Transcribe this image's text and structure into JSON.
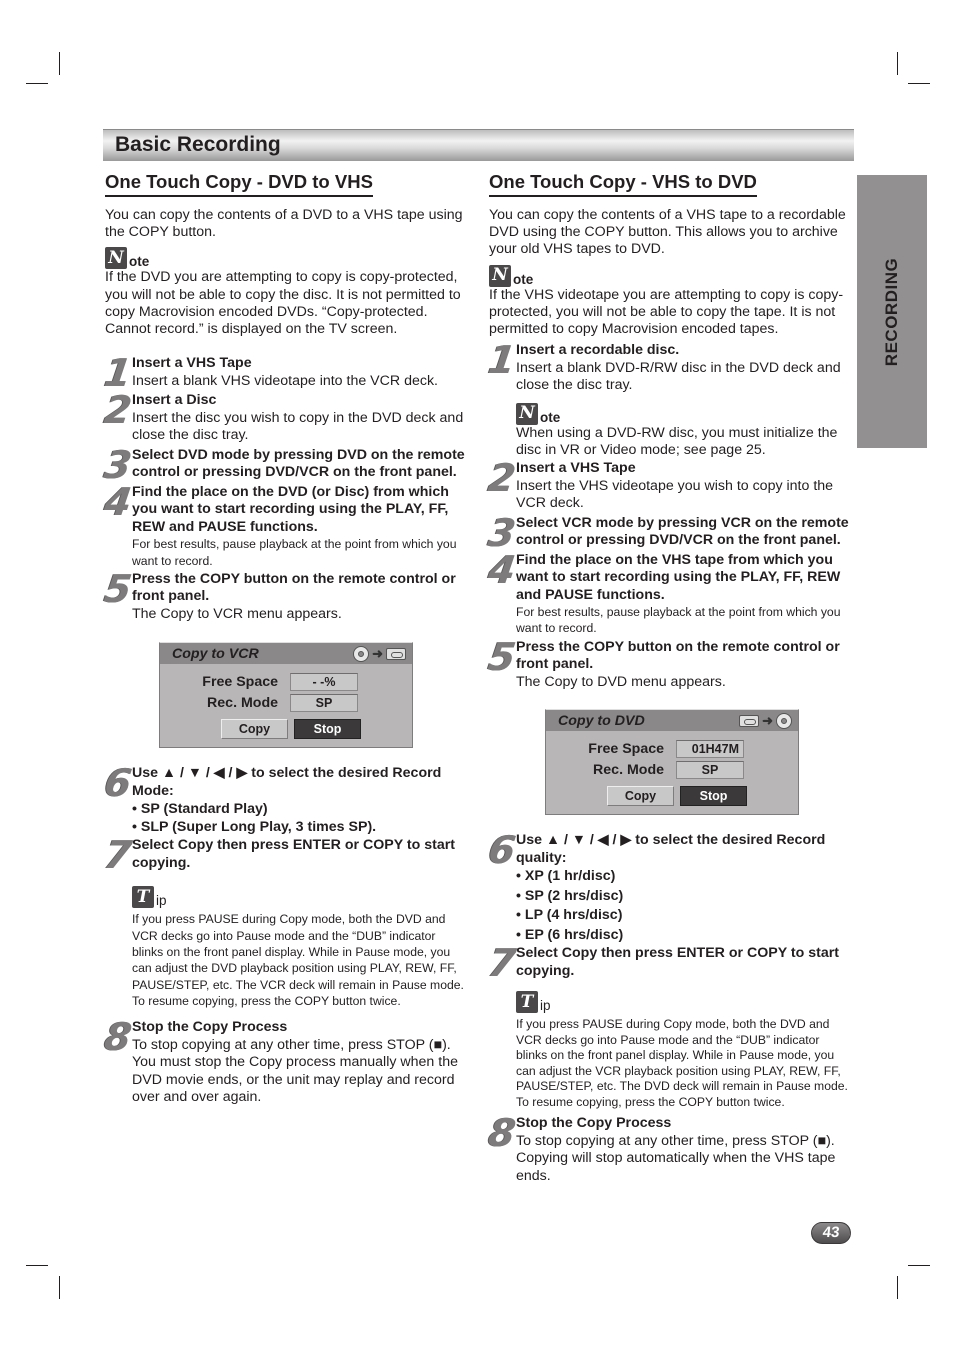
{
  "page": {
    "title": "Basic Recording",
    "side_tab": "RECORDING",
    "page_number": "43"
  },
  "left": {
    "heading": "One Touch Copy - DVD to VHS",
    "intro": "You can copy the contents of a DVD to a VHS tape using the COPY button.",
    "note": {
      "badge": "N",
      "label": "ote",
      "text": "If the DVD you are attempting to copy is copy-protected, you will not be able to copy the disc. It is not permitted to copy Macrovision encoded DVDs. “Copy-protected. Cannot record.” is displayed on the TV screen."
    },
    "steps": [
      {
        "num": "1",
        "head": "Insert a VHS Tape",
        "desc": "Insert a blank VHS videotape into the VCR deck."
      },
      {
        "num": "2",
        "head": "Insert a Disc",
        "desc": "Insert the disc you wish to copy in the DVD deck and close the disc tray."
      },
      {
        "num": "3",
        "head": "Select DVD mode by pressing DVD on the remote control or pressing DVD/VCR on the front panel.",
        "desc": ""
      },
      {
        "num": "4",
        "head": "Find the place on the DVD (or Disc) from which you want to start recording using the PLAY, FF, REW and PAUSE functions.",
        "small": "For best results, pause playback at the point from which you want to record."
      },
      {
        "num": "5",
        "head": "Press the COPY button on the remote control or front panel.",
        "desc": "The Copy to VCR menu appears."
      },
      {
        "num": "6",
        "head": "Use ▲ / ▼ / ◀ / ▶ to select the desired Record Mode:",
        "bullets": [
          "• SP (Standard Play)",
          "• SLP (Super Long Play, 3 times SP)."
        ]
      },
      {
        "num": "7",
        "head": "Select Copy then press ENTER or COPY to start copying."
      },
      {
        "num": "8",
        "head": "Stop the Copy Process",
        "desc": "To stop copying at any other time, press STOP (■). You must stop the Copy process manually when the DVD movie ends, or the unit may replay and record over and over again."
      }
    ],
    "menu": {
      "title": "Copy to VCR",
      "icons": [
        "disc-icon",
        "arrow-right-icon",
        "tape-icon"
      ],
      "arrow": "➜",
      "free_space_label": "Free Space",
      "free_space_value": "- -%",
      "rec_mode_label": "Rec. Mode",
      "rec_mode_value": "SP",
      "copy_button": "Copy",
      "stop_button": "Stop"
    },
    "tip": {
      "badge": "T",
      "label": "ip",
      "text": "If you press PAUSE during Copy mode, both the DVD and VCR decks go into Pause mode and the “DUB” indicator blinks on the front panel display. While in Pause mode, you can adjust the DVD playback position using PLAY, REW, FF, PAUSE/STEP, etc. The VCR deck will remain in Pause mode. To resume copying, press the COPY button twice."
    }
  },
  "right": {
    "heading": "One Touch Copy - VHS to DVD",
    "intro": "You can copy the contents of a VHS tape to a recordable DVD using the COPY button. This allows you to archive your old VHS tapes to DVD.",
    "note": {
      "badge": "N",
      "label": "ote",
      "text": "If the VHS videotape you are attempting to copy is copy-protected, you will not be able to copy the tape. It is not permitted to copy Macrovision encoded tapes."
    },
    "steps": [
      {
        "num": "1",
        "head": "Insert a recordable disc.",
        "desc": "Insert a blank DVD-R/RW disc in the DVD deck and close the disc tray."
      },
      {
        "num": "2",
        "head": "Insert a VHS Tape",
        "desc": "Insert the VHS videotape you wish to copy into the VCR deck."
      },
      {
        "num": "3",
        "head": "Select VCR mode by pressing VCR on the remote control or pressing DVD/VCR on the front panel."
      },
      {
        "num": "4",
        "head": "Find the place on the VHS tape from which you want to start recording using the PLAY, FF, REW and PAUSE functions.",
        "small": "For best results, pause playback at the point from which you want to record."
      },
      {
        "num": "5",
        "head": "Press the COPY button on the remote control or front panel.",
        "desc": "The Copy to DVD menu appears."
      },
      {
        "num": "6",
        "head": "Use ▲ / ▼ / ◀ / ▶ to select the desired Record quality:",
        "bullets": [
          "• XP (1 hr/disc)",
          "• SP (2 hrs/disc)",
          "• LP (4 hrs/disc)",
          "• EP (6 hrs/disc)"
        ]
      },
      {
        "num": "7",
        "head": "Select Copy then press ENTER or COPY to start copying."
      },
      {
        "num": "8",
        "head": "Stop the Copy Process",
        "desc": "To stop copying at any other time, press STOP (■). Copying will stop automatically when the VHS tape ends."
      }
    ],
    "step1_note": {
      "badge": "N",
      "label": "ote",
      "text": "When using a DVD-RW disc, you must initialize the disc in VR or Video mode; see page 25."
    },
    "menu": {
      "title": "Copy to DVD",
      "icons": [
        "tape-icon",
        "arrow-right-icon",
        "disc-icon"
      ],
      "arrow": "➜",
      "free_space_label": "Free Space",
      "free_space_value": "01H47M",
      "rec_mode_label": "Rec. Mode",
      "rec_mode_value": "SP",
      "copy_button": "Copy",
      "stop_button": "Stop"
    },
    "tip": {
      "badge": "T",
      "label": "ip",
      "text": "If you press PAUSE during Copy mode, both the DVD and VCR decks go into Pause mode and the “DUB” indicator blinks on the front panel display. While in Pause mode, you can adjust the VCR playback position using PLAY, REW, FF, PAUSE/STEP, etc. The DVD deck will remain in Pause mode. To resume copying, press the COPY button twice."
    }
  }
}
